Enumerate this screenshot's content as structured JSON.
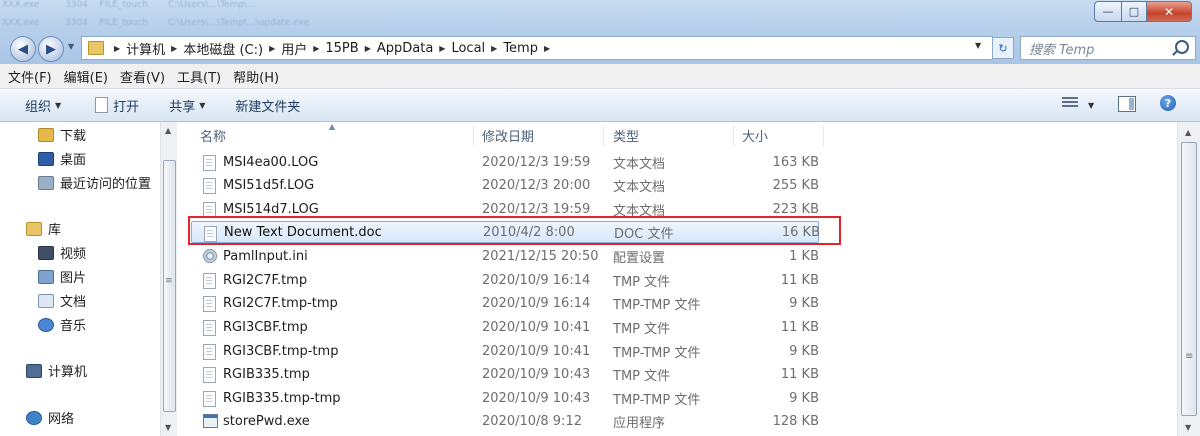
{
  "window": {
    "controls": {
      "minimize": "—",
      "maximize": "□",
      "close": "✕"
    }
  },
  "address": {
    "crumbs": [
      "计算机",
      "本地磁盘 (C:)",
      "用户",
      "15PB",
      "AppData",
      "Local",
      "Temp"
    ],
    "search_placeholder": "搜索 Temp"
  },
  "menu": [
    "文件(F)",
    "编辑(E)",
    "查看(V)",
    "工具(T)",
    "帮助(H)"
  ],
  "toolbar": {
    "organize": "组织",
    "open": "打开",
    "share": "共享",
    "new_folder": "新建文件夹"
  },
  "nav": {
    "items": [
      {
        "label": "下载",
        "icon": "downloads-icon"
      },
      {
        "label": "桌面",
        "icon": "desktop-icon"
      },
      {
        "label": "最近访问的位置",
        "icon": "recent-places-icon"
      },
      {
        "label": "库",
        "icon": "libraries-icon"
      },
      {
        "label": "视频",
        "icon": "videos-icon"
      },
      {
        "label": "图片",
        "icon": "pictures-icon"
      },
      {
        "label": "文档",
        "icon": "documents-icon"
      },
      {
        "label": "音乐",
        "icon": "music-icon"
      },
      {
        "label": "计算机",
        "icon": "computer-icon"
      },
      {
        "label": "网络",
        "icon": "network-icon"
      }
    ]
  },
  "columns": {
    "name": "名称",
    "date": "修改日期",
    "type": "类型",
    "size": "大小"
  },
  "files": [
    {
      "name": "MSI4ea00.LOG",
      "date": "2020/12/3 19:59",
      "type": "文本文档",
      "size": "163 KB",
      "icon": "text-file-icon"
    },
    {
      "name": "MSI51d5f.LOG",
      "date": "2020/12/3 20:00",
      "type": "文本文档",
      "size": "255 KB",
      "icon": "text-file-icon"
    },
    {
      "name": "MSI514d7.LOG",
      "date": "2020/12/3 19:59",
      "type": "文本文档",
      "size": "223 KB",
      "icon": "text-file-icon"
    },
    {
      "name": "New Text Document.doc",
      "date": "2010/4/2 8:00",
      "type": "DOC 文件",
      "size": "16 KB",
      "icon": "doc-file-icon",
      "selected": true
    },
    {
      "name": "PamlInput.ini",
      "date": "2021/12/15 20:50",
      "type": "配置设置",
      "size": "1 KB",
      "icon": "config-file-icon"
    },
    {
      "name": "RGI2C7F.tmp",
      "date": "2020/10/9 16:14",
      "type": "TMP 文件",
      "size": "11 KB",
      "icon": "file-icon"
    },
    {
      "name": "RGI2C7F.tmp-tmp",
      "date": "2020/10/9 16:14",
      "type": "TMP-TMP 文件",
      "size": "9 KB",
      "icon": "file-icon"
    },
    {
      "name": "RGI3CBF.tmp",
      "date": "2020/10/9 10:41",
      "type": "TMP 文件",
      "size": "11 KB",
      "icon": "file-icon"
    },
    {
      "name": "RGI3CBF.tmp-tmp",
      "date": "2020/10/9 10:41",
      "type": "TMP-TMP 文件",
      "size": "9 KB",
      "icon": "file-icon"
    },
    {
      "name": "RGIB335.tmp",
      "date": "2020/10/9 10:43",
      "type": "TMP 文件",
      "size": "11 KB",
      "icon": "file-icon"
    },
    {
      "name": "RGIB335.tmp-tmp",
      "date": "2020/10/9 10:43",
      "type": "TMP-TMP 文件",
      "size": "9 KB",
      "icon": "file-icon"
    },
    {
      "name": "storePwd.exe",
      "date": "2020/10/8 9:12",
      "type": "应用程序",
      "size": "128 KB",
      "icon": "exe-file-icon"
    }
  ]
}
